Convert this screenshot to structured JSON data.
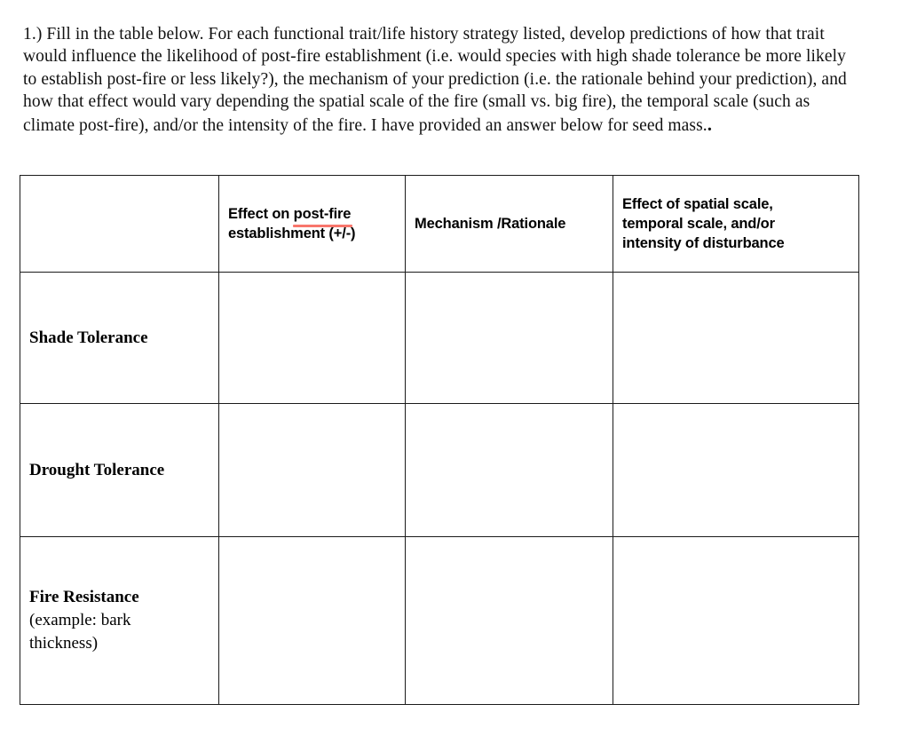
{
  "prompt": {
    "text": "1.) Fill in the table below. For each functional trait/life history strategy listed, develop predictions of how that trait would influence the likelihood of post-fire establishment (i.e. would species with high shade tolerance be more likely to establish post-fire or less likely?), the mechanism of your prediction (i.e. the rationale behind your prediction), and how that effect would vary depending the spatial scale of the fire (small vs. big fire), the temporal scale (such as climate post-fire), and/or the intensity of the fire. I have provided an answer below for seed mass.",
    "trailing_mark": "."
  },
  "table": {
    "headers": {
      "corner": "",
      "effect": {
        "line1_prefix": "Effect on ",
        "line1_underlined": "post-fire",
        "line2": "establishment (+/-)"
      },
      "mechanism": "Mechanism /Rationale",
      "scale": {
        "line1": "Effect of spatial scale,",
        "line2": "temporal scale, and/or",
        "line3": "intensity of disturbance"
      }
    },
    "rows": [
      {
        "label_bold": "Shade Tolerance",
        "label_plain_line1": "",
        "label_plain_line2": "",
        "effect": "",
        "mechanism": "",
        "scale": ""
      },
      {
        "label_bold": "Drought Tolerance",
        "label_plain_line1": "",
        "label_plain_line2": "",
        "effect": "",
        "mechanism": "",
        "scale": ""
      },
      {
        "label_bold": "Fire Resistance",
        "label_plain_line1": "(example: bark",
        "label_plain_line2": "thickness)",
        "effect": "",
        "mechanism": "",
        "scale": ""
      }
    ]
  },
  "colors": {
    "underline_accent": "#f8766c",
    "border": "#1b1b1b",
    "text": "#000000",
    "background": "#ffffff"
  }
}
